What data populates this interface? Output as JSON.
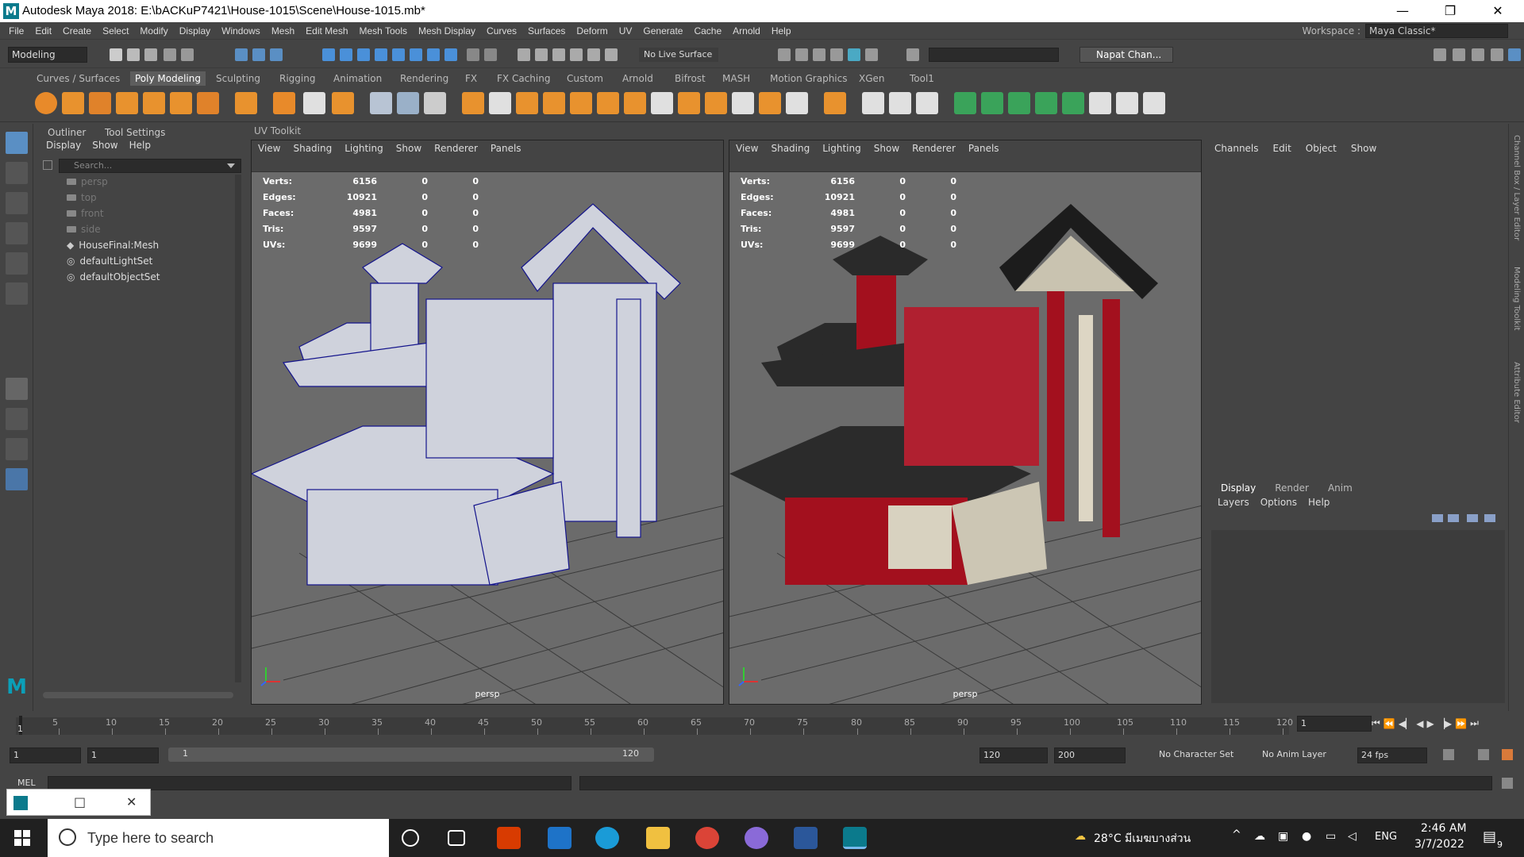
{
  "window": {
    "title": "Autodesk Maya 2018: E:\\bACKuP7421\\House-1015\\Scene\\House-1015.mb*",
    "minimize": "—",
    "maximize": "❐",
    "close": "✕"
  },
  "menubar": {
    "items": [
      "File",
      "Edit",
      "Create",
      "Select",
      "Modify",
      "Display",
      "Windows",
      "Mesh",
      "Edit Mesh",
      "Mesh Tools",
      "Mesh Display",
      "Curves",
      "Surfaces",
      "Deform",
      "UV",
      "Generate",
      "Cache",
      "Arnold",
      "Help"
    ],
    "workspace_label": "Workspace :",
    "workspace_value": "Maya Classic*"
  },
  "statusline": {
    "mode": "Modeling",
    "live_surface": "No Live Surface",
    "user": "Napat Chan..."
  },
  "shelf": {
    "tabs": [
      "Curves / Surfaces",
      "Poly Modeling",
      "Sculpting",
      "Rigging",
      "Animation",
      "Rendering",
      "FX",
      "FX Caching",
      "Custom",
      "Arnold",
      "Bifrost",
      "MASH",
      "Motion Graphics",
      "XGen",
      "Tool1"
    ],
    "active_tab": "Poly Modeling"
  },
  "outliner": {
    "tabs": [
      "Outliner",
      "Tool Settings"
    ],
    "menu": [
      "Display",
      "Show",
      "Help"
    ],
    "search_placeholder": "Search...",
    "items": [
      {
        "label": "persp"
      },
      {
        "label": "top"
      },
      {
        "label": "front"
      },
      {
        "label": "side"
      },
      {
        "label": "HouseFinal:Mesh"
      },
      {
        "label": "defaultLightSet"
      },
      {
        "label": "defaultObjectSet"
      }
    ]
  },
  "uv_toolkit_label": "UV Toolkit",
  "viewport_menu": [
    "View",
    "Shading",
    "Lighting",
    "Show",
    "Renderer",
    "Panels"
  ],
  "hud": {
    "rows": [
      {
        "label": "Verts:",
        "value": "6156",
        "a": "0",
        "b": "0"
      },
      {
        "label": "Edges:",
        "value": "10921",
        "a": "0",
        "b": "0"
      },
      {
        "label": "Faces:",
        "value": "4981",
        "a": "0",
        "b": "0"
      },
      {
        "label": "Tris:",
        "value": "9597",
        "a": "0",
        "b": "0"
      },
      {
        "label": "UVs:",
        "value": "9699",
        "a": "0",
        "b": "0"
      }
    ]
  },
  "viewport_camera": "persp",
  "channelbox": {
    "menu": [
      "Channels",
      "Edit",
      "Object",
      "Show"
    ]
  },
  "layers": {
    "tabs": [
      "Display",
      "Render",
      "Anim"
    ],
    "menu": [
      "Layers",
      "Options",
      "Help"
    ]
  },
  "side_tabs": [
    "Channel Box / Layer Editor",
    "Modeling Toolkit",
    "Attribute Editor"
  ],
  "timeline": {
    "ticks": [
      "5",
      "10",
      "15",
      "20",
      "25",
      "30",
      "35",
      "40",
      "45",
      "50",
      "55",
      "60",
      "65",
      "70",
      "75",
      "80",
      "85",
      "90",
      "95",
      "100",
      "105",
      "110",
      "115",
      "120"
    ],
    "start_marker": "1",
    "current_frame": "1"
  },
  "range": {
    "start": "1",
    "inner_start": "1",
    "bar_start": "1",
    "bar_end": "120",
    "end": "120",
    "max": "200",
    "character_set": "No Character Set",
    "anim_layer": "No Anim Layer",
    "fps": "24 fps"
  },
  "cmdline": {
    "label": "MEL"
  },
  "taskbar": {
    "search_placeholder": "Type here to search",
    "weather": "28°C มีเมฆบางส่วน",
    "language": "ENG",
    "time": "2:46 AM",
    "date": "3/7/2022",
    "notification_count": "9"
  },
  "colors": {
    "maya_blue": "#0b7a8c",
    "viewport_bg": "#6b6b6b",
    "panel_bg": "#444444",
    "roof_red": "#a3101e",
    "wire_blue": "#14148c"
  }
}
